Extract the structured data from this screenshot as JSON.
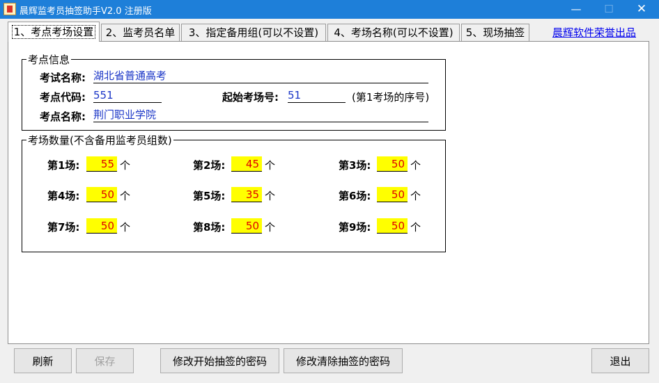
{
  "window": {
    "title": "晨辉监考员抽签助手V2.0 注册版",
    "minimize_glyph": "—",
    "maximize_glyph": "☐",
    "close_glyph": "✕",
    "icon": "app-icon"
  },
  "tabs": [
    {
      "label": "1、考点考场设置",
      "active": true
    },
    {
      "label": "2、监考员名单",
      "active": false
    },
    {
      "label": "3、指定备用组(可以不设置)",
      "active": false
    },
    {
      "label": "4、考场名称(可以不设置)",
      "active": false
    },
    {
      "label": "5、现场抽签",
      "active": false
    }
  ],
  "credit_link": "晨辉软件荣誉出品",
  "site_info": {
    "legend": "考点信息",
    "exam_name_label": "考试名称:",
    "exam_name_value": "湖北省普通高考",
    "site_code_label": "考点代码:",
    "site_code_value": "551",
    "start_room_label": "起始考场号:",
    "start_room_value": "51",
    "start_room_note": "(第1考场的序号)",
    "site_name_label": "考点名称:",
    "site_name_value": "荆门职业学院"
  },
  "room_counts": {
    "legend": "考场数量(不含备用监考员组数)",
    "unit": "个",
    "rooms": [
      {
        "label": "第1场:",
        "value": "55"
      },
      {
        "label": "第2场:",
        "value": "45"
      },
      {
        "label": "第3场:",
        "value": "50"
      },
      {
        "label": "第4场:",
        "value": "50"
      },
      {
        "label": "第5场:",
        "value": "35"
      },
      {
        "label": "第6场:",
        "value": "50"
      },
      {
        "label": "第7场:",
        "value": "50"
      },
      {
        "label": "第8场:",
        "value": "50"
      },
      {
        "label": "第9场:",
        "value": "50"
      }
    ]
  },
  "buttons": {
    "refresh": "刷新",
    "save": "保存",
    "change_start_password": "修改开始抽签的密码",
    "change_clear_password": "修改清除抽签的密码",
    "exit": "退出"
  },
  "colors": {
    "titlebar": "#1e7fd9",
    "value_text": "#1a35c7",
    "count_bg": "#ffff00",
    "count_text": "#e00000",
    "link": "#0000ee"
  }
}
